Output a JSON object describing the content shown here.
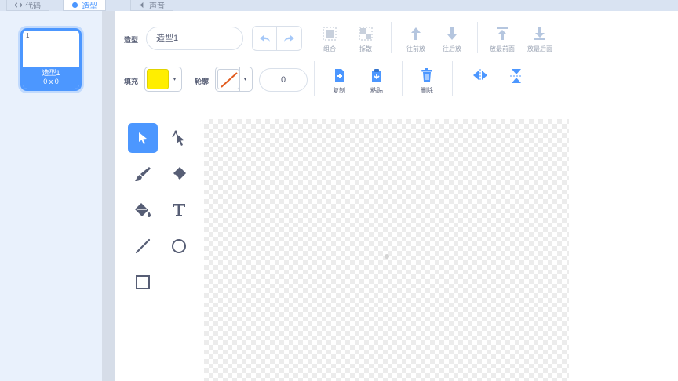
{
  "tabs": [
    {
      "label": "代码",
      "icon": "code-icon",
      "active": false
    },
    {
      "label": "造型",
      "icon": "costume-icon",
      "active": true
    },
    {
      "label": "声音",
      "icon": "sound-icon",
      "active": false
    }
  ],
  "costume": {
    "index": "1",
    "name": "造型1",
    "size": "0 x 0"
  },
  "toolbar": {
    "name_label": "造型",
    "name_value": "造型1",
    "group": "组合",
    "ungroup": "拆散",
    "forward": "往前放",
    "backward": "往后放",
    "front": "放最前面",
    "back": "放最后面",
    "fill_label": "填充",
    "outline_label": "轮廓",
    "outline_width": "0",
    "copy": "复制",
    "paste": "粘贴",
    "delete": "删除"
  },
  "colors": {
    "accent": "#4c97ff",
    "fill": "#ffee00",
    "outline_none": "#e25c1f"
  }
}
